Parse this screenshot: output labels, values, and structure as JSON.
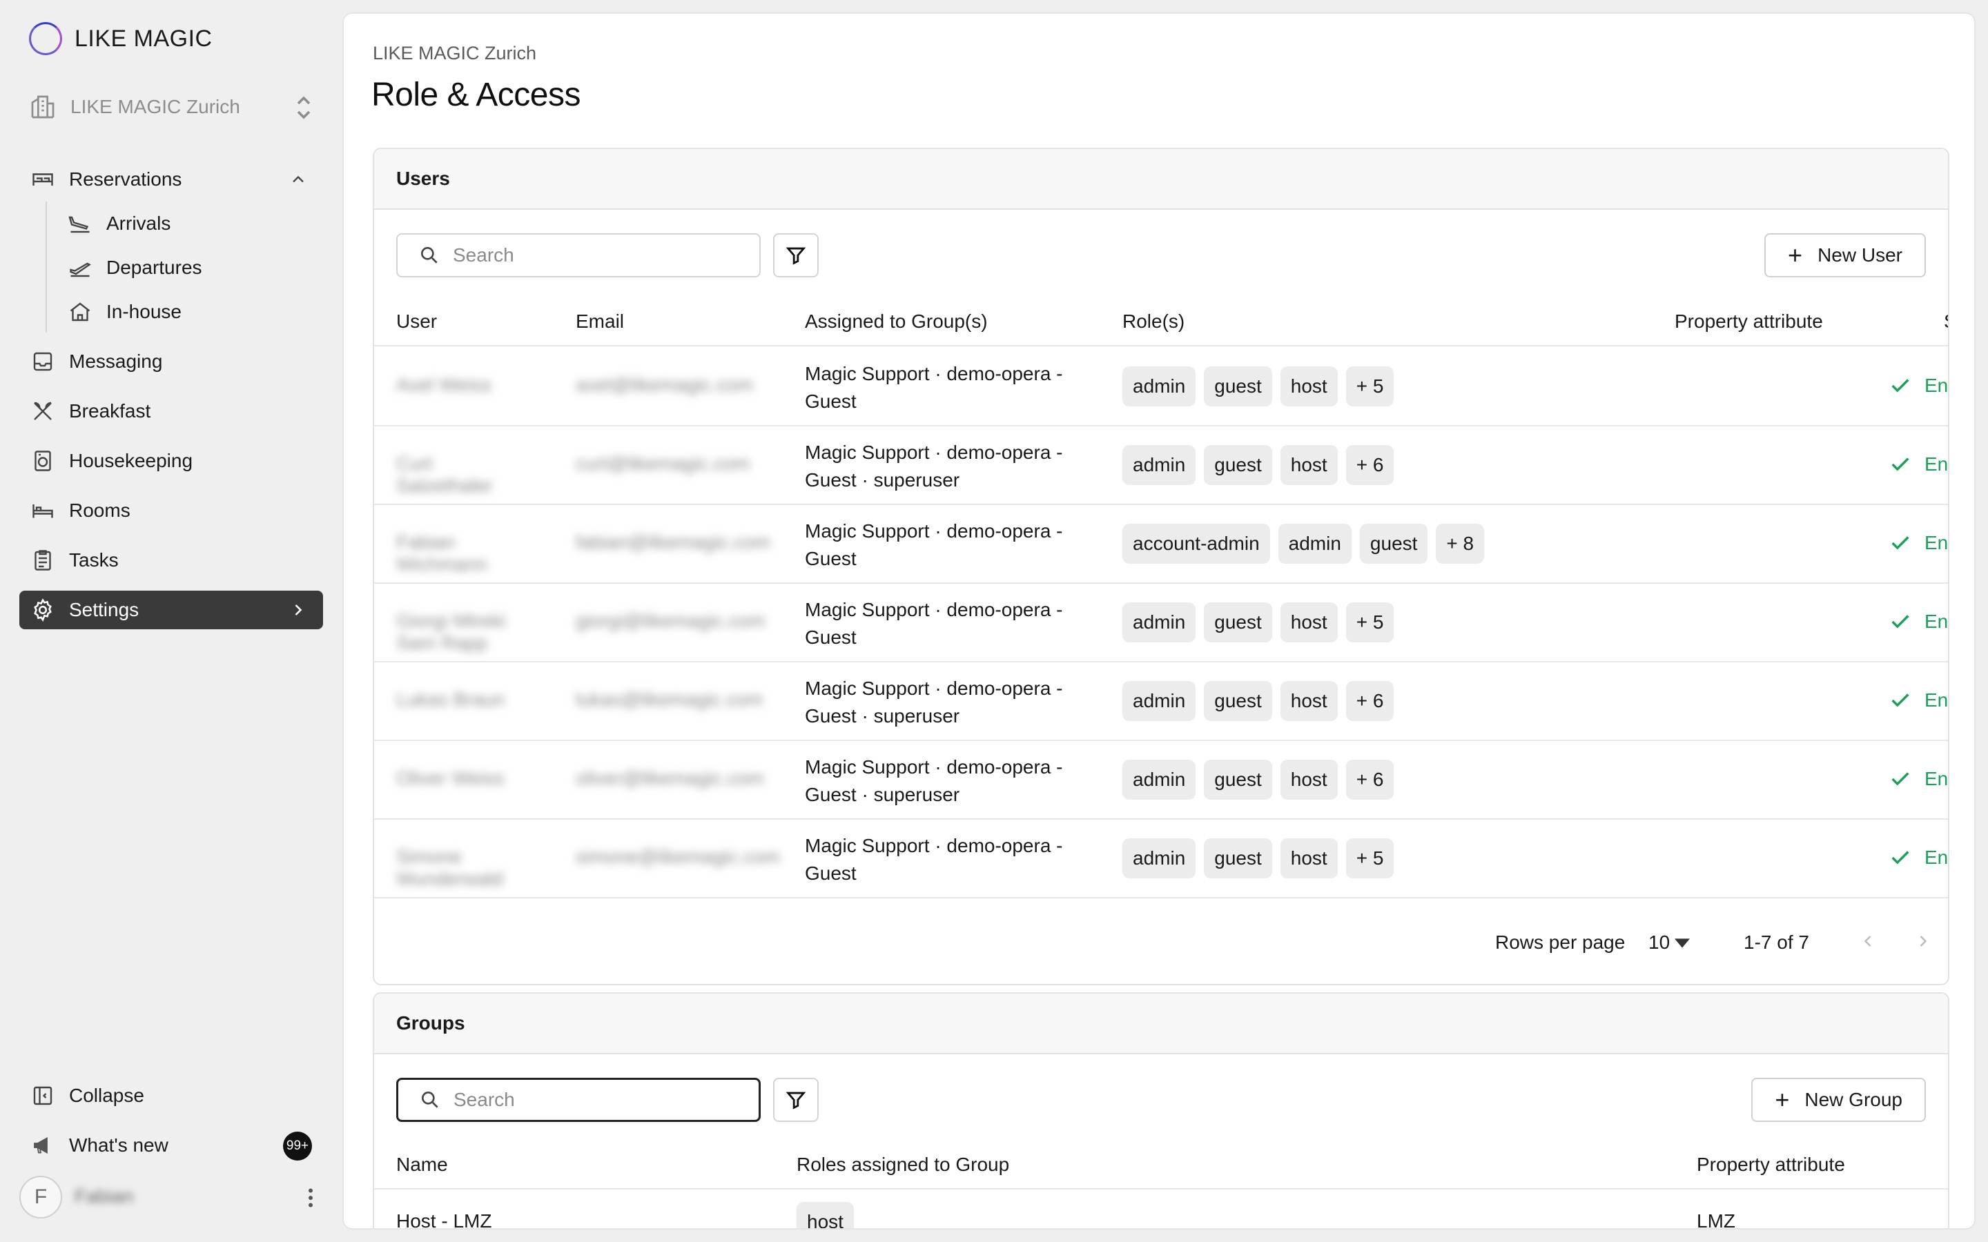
{
  "sidebar": {
    "brand": "LIKE MAGIC",
    "property": "LIKE MAGIC Zurich",
    "reservations": "Reservations",
    "arrivals": "Arrivals",
    "departures": "Departures",
    "inhouse": "In-house",
    "messaging": "Messaging",
    "breakfast": "Breakfast",
    "housekeeping": "Housekeeping",
    "rooms": "Rooms",
    "tasks": "Tasks",
    "settings": "Settings",
    "collapse": "Collapse",
    "whats_new": "What's new",
    "whats_new_badge": "99+",
    "avatar_initial": "F",
    "username": "Fabian"
  },
  "page": {
    "breadcrumb": "LIKE MAGIC Zurich",
    "title": "Role & Access"
  },
  "users": {
    "title": "Users",
    "search_placeholder": "Search",
    "new_button": "New User",
    "columns": [
      "User",
      "Email",
      "Assigned to Group(s)",
      "Role(s)",
      "Property attribute",
      "S"
    ],
    "rows": [
      {
        "user": "Axel Weiss",
        "email": "axel@likemagic.com",
        "groups_1": "Magic Support · demo-opera -",
        "groups_2": "Guest",
        "roles": [
          "admin",
          "guest",
          "host",
          "+ 5"
        ],
        "status": "En"
      },
      {
        "user": "Curt Salzethaler",
        "email": "curt@likemagic.com",
        "groups_1": "Magic Support · demo-opera -",
        "groups_2": "Guest · superuser",
        "roles": [
          "admin",
          "guest",
          "host",
          "+ 6"
        ],
        "status": "En"
      },
      {
        "user": "Fabian Wichmann",
        "email": "fabian@likemagic.com",
        "groups_1": "Magic Support · demo-opera -",
        "groups_2": "Guest",
        "roles": [
          "account-admin",
          "admin",
          "guest",
          "+ 8"
        ],
        "status": "En"
      },
      {
        "user": "Giorgi Mtreki Sam Rapp",
        "email": "giorgi@likemagic.com",
        "groups_1": "Magic Support · demo-opera -",
        "groups_2": "Guest",
        "roles": [
          "admin",
          "guest",
          "host",
          "+ 5"
        ],
        "status": "En"
      },
      {
        "user": "Lukas Braun",
        "email": "lukas@likemagic.com",
        "groups_1": "Magic Support · demo-opera -",
        "groups_2": "Guest · superuser",
        "roles": [
          "admin",
          "guest",
          "host",
          "+ 6"
        ],
        "status": "En"
      },
      {
        "user": "Oliver Weiss",
        "email": "oliver@likemagic.com",
        "groups_1": "Magic Support · demo-opera -",
        "groups_2": "Guest · superuser",
        "roles": [
          "admin",
          "guest",
          "host",
          "+ 6"
        ],
        "status": "En"
      },
      {
        "user": "Simone Wunderwald",
        "email": "simone@likemagic.com",
        "groups_1": "Magic Support · demo-opera -",
        "groups_2": "Guest",
        "roles": [
          "admin",
          "guest",
          "host",
          "+ 5"
        ],
        "status": "En"
      }
    ],
    "pager": {
      "rows_label": "Rows per page",
      "rows_value": "10",
      "range": "1-7 of 7"
    }
  },
  "groups": {
    "title": "Groups",
    "search_placeholder": "Search",
    "new_button": "New Group",
    "columns": [
      "Name",
      "Roles assigned to Group",
      "Property attribute"
    ],
    "first_row": {
      "name": "Host - LMZ",
      "role": "host",
      "property": "LMZ"
    }
  },
  "colors": {
    "accent_active": "#3a3a3a",
    "status_green": "#1aa05a",
    "chip_bg": "#ececec"
  }
}
